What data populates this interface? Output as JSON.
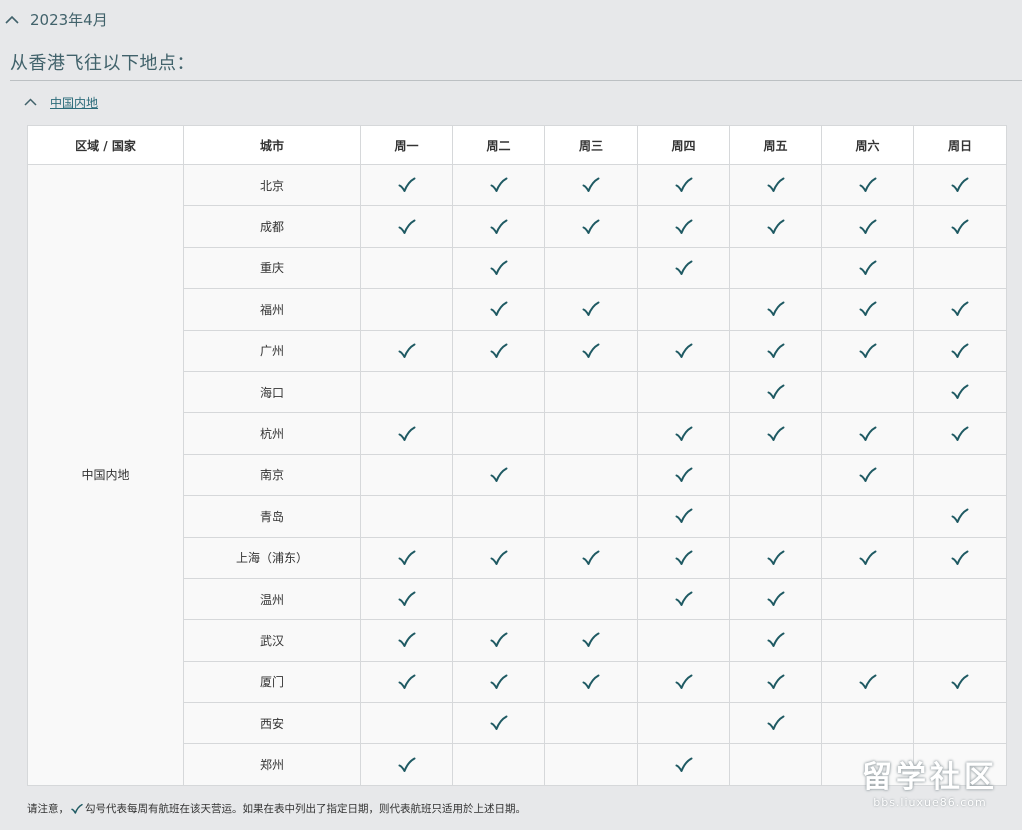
{
  "month": {
    "label": "2023年4月"
  },
  "section": {
    "title": "从香港飞往以下地点："
  },
  "region": {
    "link_label": "中国内地"
  },
  "table": {
    "headers": [
      "区域 / 国家",
      "城市",
      "周一",
      "周二",
      "周三",
      "周四",
      "周五",
      "周六",
      "周日"
    ],
    "region_name": "中国内地",
    "rows": [
      {
        "city": "北京",
        "days": [
          1,
          1,
          1,
          1,
          1,
          1,
          1
        ]
      },
      {
        "city": "成都",
        "days": [
          1,
          1,
          1,
          1,
          1,
          1,
          1
        ]
      },
      {
        "city": "重庆",
        "days": [
          0,
          1,
          0,
          1,
          0,
          1,
          0
        ]
      },
      {
        "city": "福州",
        "days": [
          0,
          1,
          1,
          0,
          1,
          1,
          1
        ]
      },
      {
        "city": "广州",
        "days": [
          1,
          1,
          1,
          1,
          1,
          1,
          1
        ]
      },
      {
        "city": "海口",
        "days": [
          0,
          0,
          0,
          0,
          1,
          0,
          1
        ]
      },
      {
        "city": "杭州",
        "days": [
          1,
          0,
          0,
          1,
          1,
          1,
          1
        ]
      },
      {
        "city": "南京",
        "days": [
          0,
          1,
          0,
          1,
          0,
          1,
          0
        ]
      },
      {
        "city": "青岛",
        "days": [
          0,
          0,
          0,
          1,
          0,
          0,
          1
        ]
      },
      {
        "city": "上海（浦东）",
        "days": [
          1,
          1,
          1,
          1,
          1,
          1,
          1
        ]
      },
      {
        "city": "温州",
        "days": [
          1,
          0,
          0,
          1,
          1,
          0,
          0
        ]
      },
      {
        "city": "武汉",
        "days": [
          1,
          1,
          1,
          0,
          1,
          0,
          0
        ]
      },
      {
        "city": "厦门",
        "days": [
          1,
          1,
          1,
          1,
          1,
          1,
          1
        ]
      },
      {
        "city": "西安",
        "days": [
          0,
          1,
          0,
          0,
          1,
          0,
          0
        ]
      },
      {
        "city": "郑州",
        "days": [
          1,
          0,
          0,
          1,
          0,
          0,
          0
        ]
      }
    ]
  },
  "footnote": {
    "prefix": "请注意，",
    "suffix": "勾号代表每周有航班在该天营运。如果在表中列出了指定日期，则代表航班只适用於上述日期。"
  },
  "watermark": {
    "title": "留学社区",
    "url": "bbs.liuxue86.com"
  },
  "icons": {
    "toggle": "chevron-up-icon",
    "available": "check-icon"
  },
  "colors": {
    "accent": "#41626b",
    "check": "#1f5a63",
    "link": "#2b6b7a"
  }
}
